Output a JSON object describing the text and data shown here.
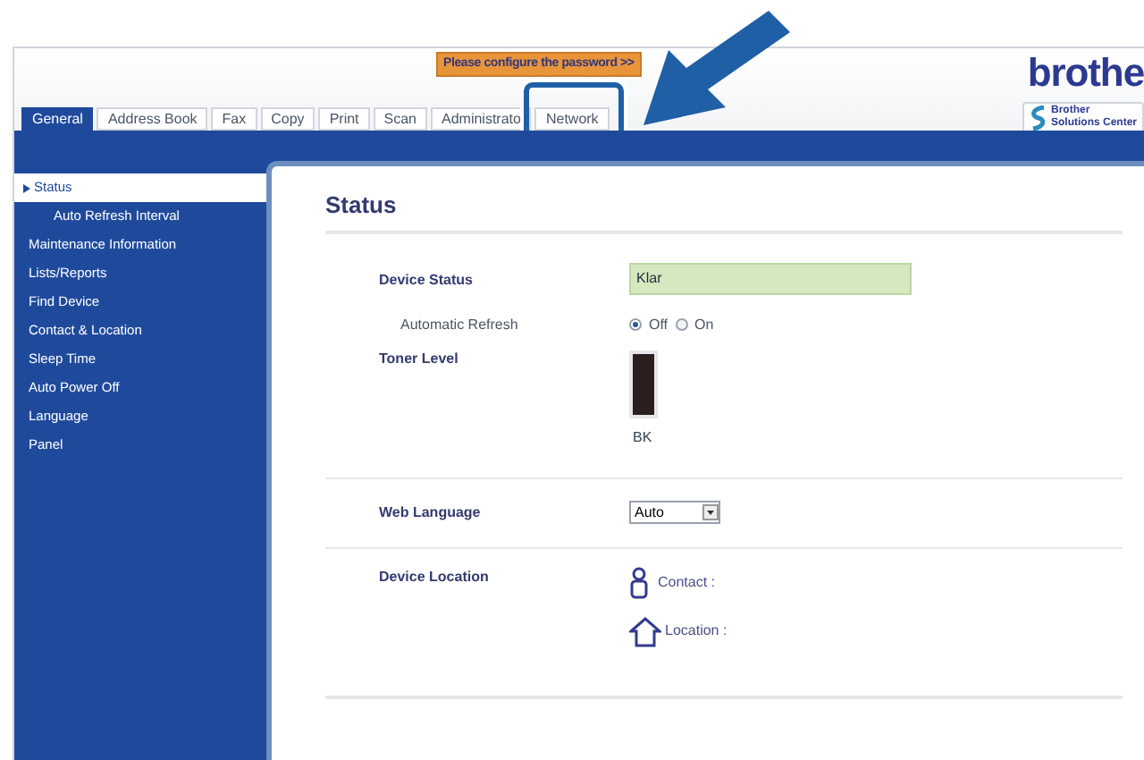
{
  "header": {
    "password_button": "Please configure the password >>",
    "logo": "brothe",
    "solutions_center": [
      "Brother",
      "Solutions Center"
    ]
  },
  "tabs": [
    {
      "label": "General",
      "selected": true,
      "highlighted": false
    },
    {
      "label": "Address Book",
      "selected": false,
      "highlighted": false
    },
    {
      "label": "Fax",
      "selected": false,
      "highlighted": false
    },
    {
      "label": "Copy",
      "selected": false,
      "highlighted": false
    },
    {
      "label": "Print",
      "selected": false,
      "highlighted": false
    },
    {
      "label": "Scan",
      "selected": false,
      "highlighted": false
    },
    {
      "label": "Administrato",
      "selected": false,
      "highlighted": false
    },
    {
      "label": "Network",
      "selected": false,
      "highlighted": true
    }
  ],
  "sidebar": {
    "items": [
      {
        "label": "Status",
        "selected": true,
        "children": [
          {
            "label": "Auto Refresh Interval",
            "selected": false
          }
        ]
      },
      {
        "label": "Maintenance Information",
        "selected": false
      },
      {
        "label": "Lists/Reports",
        "selected": false
      },
      {
        "label": "Find Device",
        "selected": false
      },
      {
        "label": "Contact & Location",
        "selected": false
      },
      {
        "label": "Sleep Time",
        "selected": false
      },
      {
        "label": "Auto Power Off",
        "selected": false
      },
      {
        "label": "Language",
        "selected": false
      },
      {
        "label": "Panel",
        "selected": false
      }
    ]
  },
  "content": {
    "title": "Status",
    "device_status": {
      "label": "Device Status",
      "value": "Klar"
    },
    "automatic_refresh": {
      "label": "Automatic Refresh",
      "options": [
        {
          "label": "Off",
          "selected": true
        },
        {
          "label": "On",
          "selected": false
        }
      ]
    },
    "toner": {
      "label": "Toner Level",
      "level": 1,
      "name": "BK"
    },
    "web_language": {
      "label": "Web Language",
      "value": "Auto"
    },
    "device_location": {
      "label": "Device Location",
      "contact": "Contact :",
      "location": "Location :"
    }
  }
}
